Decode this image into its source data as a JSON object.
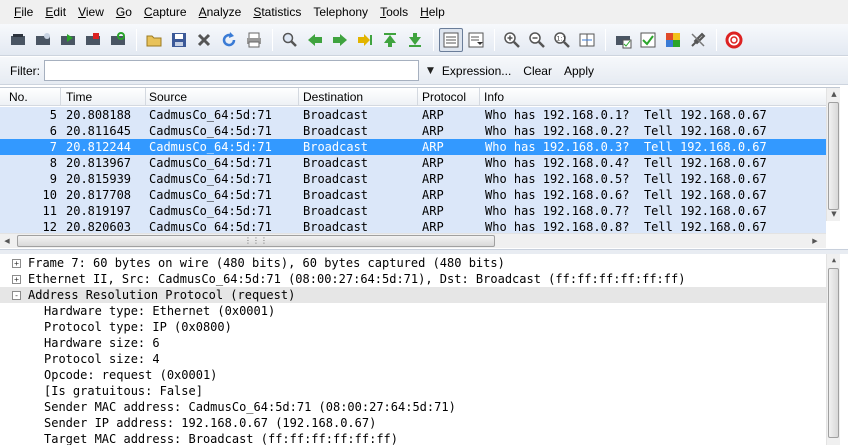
{
  "menu": {
    "items": [
      {
        "u": "F",
        "rest": "ile"
      },
      {
        "u": "E",
        "rest": "dit"
      },
      {
        "u": "V",
        "rest": "iew"
      },
      {
        "u": "G",
        "rest": "o"
      },
      {
        "u": "C",
        "rest": "apture"
      },
      {
        "u": "A",
        "rest": "nalyze"
      },
      {
        "u": "S",
        "rest": "tatistics"
      },
      {
        "u": "",
        "rest": "Telephony"
      },
      {
        "u": "T",
        "rest": "ools"
      },
      {
        "u": "H",
        "rest": "elp"
      }
    ]
  },
  "toolbar": {
    "icons": [
      "interfaces-icon",
      "capture-options-icon",
      "start-capture-icon",
      "stop-capture-icon",
      "restart-capture-icon",
      "open-file-icon",
      "save-file-icon",
      "close-file-icon",
      "reload-icon",
      "print-icon",
      "find-icon",
      "back-icon",
      "forward-icon",
      "go-to-packet-icon",
      "first-packet-icon",
      "last-packet-icon",
      "colorize-icon",
      "auto-scroll-icon",
      "zoom-in-icon",
      "zoom-out-icon",
      "normal-size-icon",
      "resize-columns-icon",
      "capture-filters-icon",
      "display-filters-icon",
      "coloring-rules-icon",
      "preferences-icon",
      "help-icon"
    ]
  },
  "filter": {
    "label": "Filter:",
    "value": "",
    "expression_label": "Expression...",
    "clear_label": "Clear",
    "apply_label": "Apply"
  },
  "packet_list": {
    "columns": [
      "No.",
      "Time",
      "Source",
      "Destination",
      "Protocol",
      "Info"
    ],
    "rows": [
      {
        "no": "5",
        "time": "20.808188",
        "src": "CadmusCo_64:5d:71",
        "dst": "Broadcast",
        "proto": "ARP",
        "info": "Who has 192.168.0.1?  Tell 192.168.0.67"
      },
      {
        "no": "6",
        "time": "20.811645",
        "src": "CadmusCo_64:5d:71",
        "dst": "Broadcast",
        "proto": "ARP",
        "info": "Who has 192.168.0.2?  Tell 192.168.0.67"
      },
      {
        "no": "7",
        "time": "20.812244",
        "src": "CadmusCo_64:5d:71",
        "dst": "Broadcast",
        "proto": "ARP",
        "info": "Who has 192.168.0.3?  Tell 192.168.0.67"
      },
      {
        "no": "8",
        "time": "20.813967",
        "src": "CadmusCo_64:5d:71",
        "dst": "Broadcast",
        "proto": "ARP",
        "info": "Who has 192.168.0.4?  Tell 192.168.0.67"
      },
      {
        "no": "9",
        "time": "20.815939",
        "src": "CadmusCo_64:5d:71",
        "dst": "Broadcast",
        "proto": "ARP",
        "info": "Who has 192.168.0.5?  Tell 192.168.0.67"
      },
      {
        "no": "10",
        "time": "20.817708",
        "src": "CadmusCo_64:5d:71",
        "dst": "Broadcast",
        "proto": "ARP",
        "info": "Who has 192.168.0.6?  Tell 192.168.0.67"
      },
      {
        "no": "11",
        "time": "20.819197",
        "src": "CadmusCo_64:5d:71",
        "dst": "Broadcast",
        "proto": "ARP",
        "info": "Who has 192.168.0.7?  Tell 192.168.0.67"
      },
      {
        "no": "12",
        "time": "20.820603",
        "src": "CadmusCo_64:5d:71",
        "dst": "Broadcast",
        "proto": "ARP",
        "info": "Who has 192.168.0.8?  Tell 192.168.0.67"
      }
    ],
    "selected_no": "7",
    "row_color": "#dbe7f9",
    "selected_color": "#3399ff"
  },
  "details": {
    "rows": [
      {
        "expander": "+",
        "indent": 0,
        "text": "Frame 7: 60 bytes on wire (480 bits), 60 bytes captured (480 bits)"
      },
      {
        "expander": "+",
        "indent": 0,
        "text": "Ethernet II, Src: CadmusCo_64:5d:71 (08:00:27:64:5d:71), Dst: Broadcast (ff:ff:ff:ff:ff:ff)"
      },
      {
        "expander": "-",
        "indent": 0,
        "text": "Address Resolution Protocol (request)",
        "highlight": true
      },
      {
        "expander": "",
        "indent": 1,
        "text": "Hardware type: Ethernet (0x0001)"
      },
      {
        "expander": "",
        "indent": 1,
        "text": "Protocol type: IP (0x0800)"
      },
      {
        "expander": "",
        "indent": 1,
        "text": "Hardware size: 6"
      },
      {
        "expander": "",
        "indent": 1,
        "text": "Protocol size: 4"
      },
      {
        "expander": "",
        "indent": 1,
        "text": "Opcode: request (0x0001)"
      },
      {
        "expander": "",
        "indent": 1,
        "text": "[Is gratuitous: False]"
      },
      {
        "expander": "",
        "indent": 1,
        "text": "Sender MAC address: CadmusCo_64:5d:71 (08:00:27:64:5d:71)"
      },
      {
        "expander": "",
        "indent": 1,
        "text": "Sender IP address: 192.168.0.67 (192.168.0.67)"
      },
      {
        "expander": "",
        "indent": 1,
        "text": "Target MAC address: Broadcast (ff:ff:ff:ff:ff:ff)"
      }
    ]
  }
}
